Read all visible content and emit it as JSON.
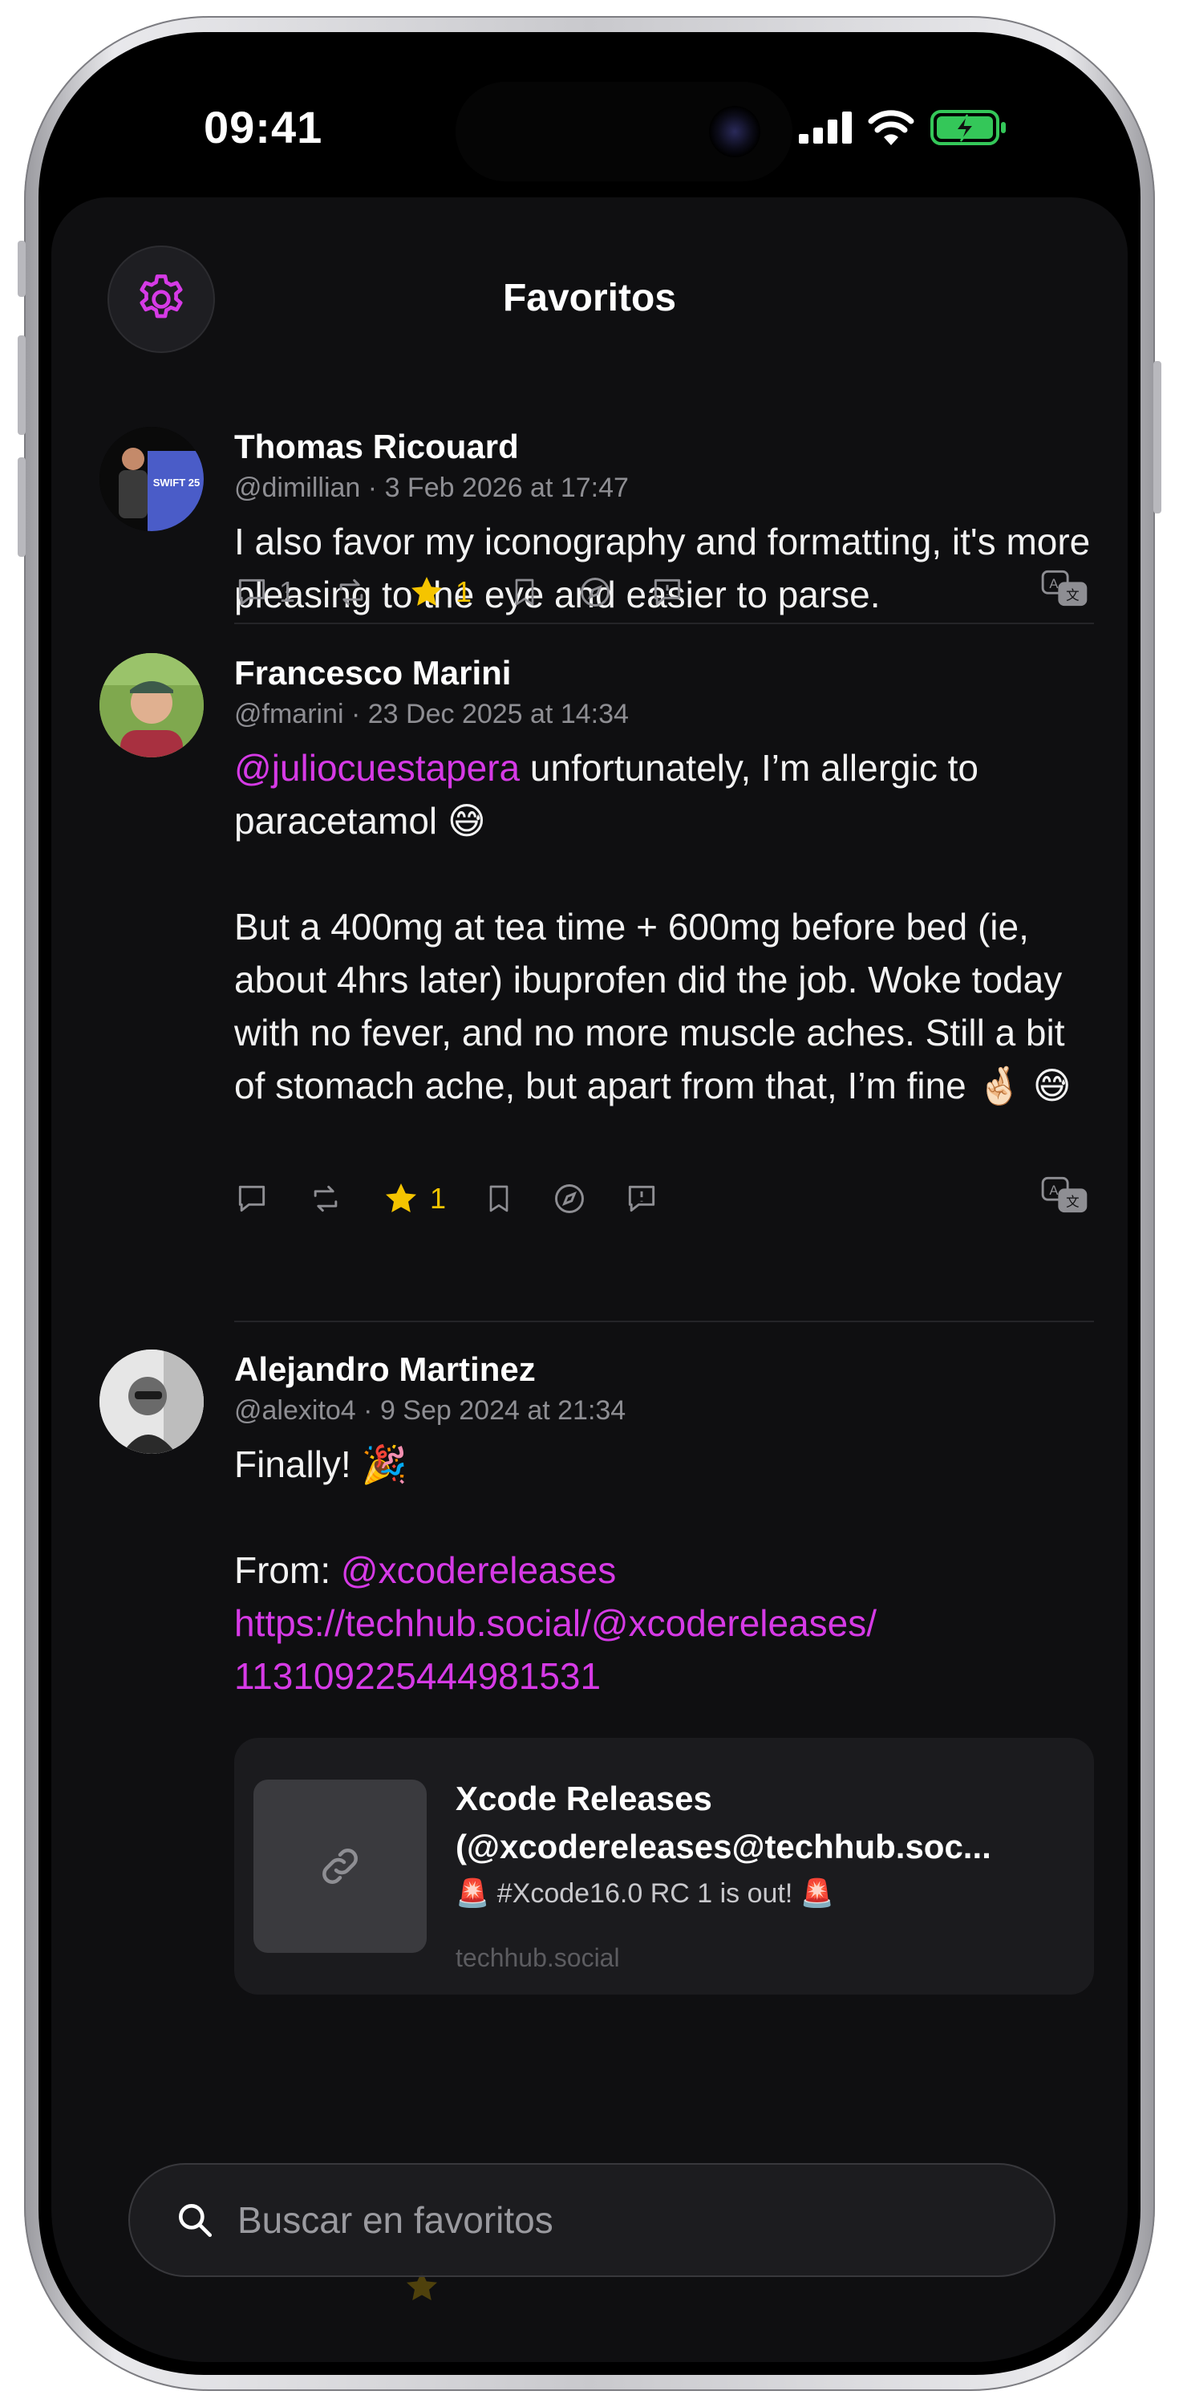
{
  "status_bar": {
    "time": "09:41"
  },
  "header": {
    "title": "Favoritos"
  },
  "posts": [
    {
      "name": "Thomas Ricouard",
      "handle": "@dimillian",
      "date": "3 Feb 2026 at 17:47",
      "text": "I also favor my iconography and formatting, it's more pleasing to the eye and easier to parse.",
      "actions": {
        "replies": "1",
        "favorites": "1"
      },
      "avatar_label": "SWIFT 25"
    },
    {
      "name": "Francesco Marini",
      "handle": "@fmarini",
      "date": "23 Dec 2025 at 14:34",
      "mention": "@juliocuestapera",
      "text_after_mention": " unfortunately, I’m allergic to paracetamol 😅",
      "text_2": "But a 400mg at tea time + 600mg before bed (ie, about 4hrs later) ibuprofen did the job. Woke today with no fever, and no more muscle aches. Still a bit of stomach ache, but apart from that, I’m fine 🤞🏻 😅",
      "actions": {
        "favorites": "1"
      }
    },
    {
      "name": "Alejandro Martinez",
      "handle": "@alexito4",
      "date": "9 Sep 2024 at 21:34",
      "text_1": "Finally! 🎉",
      "from_label": "From: ",
      "from_mention": "@xcodereleases",
      "link": "https://techhub.social/@xcodereleases/\n113109225444981531",
      "card": {
        "title": "Xcode Releases\n(@xcodereleases@techhub.soc...",
        "subtitle": "🚨 #Xcode16.0 RC 1 is out! 🚨",
        "domain": "techhub.social"
      }
    }
  ],
  "search": {
    "placeholder": "Buscar en favoritos"
  },
  "colors": {
    "accent": "#d63ae6",
    "star": "#f5c400",
    "background": "#0f0f11"
  }
}
